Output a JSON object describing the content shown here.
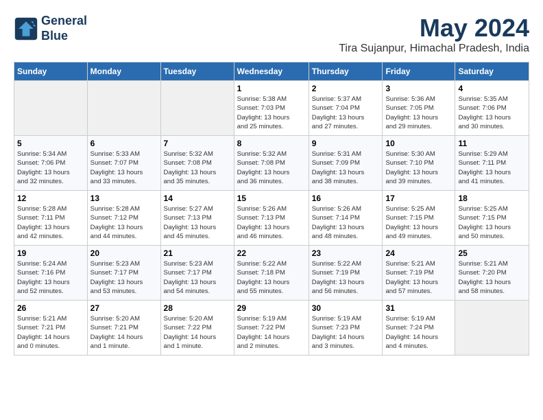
{
  "header": {
    "logo_line1": "General",
    "logo_line2": "Blue",
    "month": "May 2024",
    "location": "Tira Sujanpur, Himachal Pradesh, India"
  },
  "weekdays": [
    "Sunday",
    "Monday",
    "Tuesday",
    "Wednesday",
    "Thursday",
    "Friday",
    "Saturday"
  ],
  "weeks": [
    [
      {
        "day": "",
        "info": ""
      },
      {
        "day": "",
        "info": ""
      },
      {
        "day": "",
        "info": ""
      },
      {
        "day": "1",
        "info": "Sunrise: 5:38 AM\nSunset: 7:03 PM\nDaylight: 13 hours\nand 25 minutes."
      },
      {
        "day": "2",
        "info": "Sunrise: 5:37 AM\nSunset: 7:04 PM\nDaylight: 13 hours\nand 27 minutes."
      },
      {
        "day": "3",
        "info": "Sunrise: 5:36 AM\nSunset: 7:05 PM\nDaylight: 13 hours\nand 29 minutes."
      },
      {
        "day": "4",
        "info": "Sunrise: 5:35 AM\nSunset: 7:06 PM\nDaylight: 13 hours\nand 30 minutes."
      }
    ],
    [
      {
        "day": "5",
        "info": "Sunrise: 5:34 AM\nSunset: 7:06 PM\nDaylight: 13 hours\nand 32 minutes."
      },
      {
        "day": "6",
        "info": "Sunrise: 5:33 AM\nSunset: 7:07 PM\nDaylight: 13 hours\nand 33 minutes."
      },
      {
        "day": "7",
        "info": "Sunrise: 5:32 AM\nSunset: 7:08 PM\nDaylight: 13 hours\nand 35 minutes."
      },
      {
        "day": "8",
        "info": "Sunrise: 5:32 AM\nSunset: 7:08 PM\nDaylight: 13 hours\nand 36 minutes."
      },
      {
        "day": "9",
        "info": "Sunrise: 5:31 AM\nSunset: 7:09 PM\nDaylight: 13 hours\nand 38 minutes."
      },
      {
        "day": "10",
        "info": "Sunrise: 5:30 AM\nSunset: 7:10 PM\nDaylight: 13 hours\nand 39 minutes."
      },
      {
        "day": "11",
        "info": "Sunrise: 5:29 AM\nSunset: 7:11 PM\nDaylight: 13 hours\nand 41 minutes."
      }
    ],
    [
      {
        "day": "12",
        "info": "Sunrise: 5:28 AM\nSunset: 7:11 PM\nDaylight: 13 hours\nand 42 minutes."
      },
      {
        "day": "13",
        "info": "Sunrise: 5:28 AM\nSunset: 7:12 PM\nDaylight: 13 hours\nand 44 minutes."
      },
      {
        "day": "14",
        "info": "Sunrise: 5:27 AM\nSunset: 7:13 PM\nDaylight: 13 hours\nand 45 minutes."
      },
      {
        "day": "15",
        "info": "Sunrise: 5:26 AM\nSunset: 7:13 PM\nDaylight: 13 hours\nand 46 minutes."
      },
      {
        "day": "16",
        "info": "Sunrise: 5:26 AM\nSunset: 7:14 PM\nDaylight: 13 hours\nand 48 minutes."
      },
      {
        "day": "17",
        "info": "Sunrise: 5:25 AM\nSunset: 7:15 PM\nDaylight: 13 hours\nand 49 minutes."
      },
      {
        "day": "18",
        "info": "Sunrise: 5:25 AM\nSunset: 7:15 PM\nDaylight: 13 hours\nand 50 minutes."
      }
    ],
    [
      {
        "day": "19",
        "info": "Sunrise: 5:24 AM\nSunset: 7:16 PM\nDaylight: 13 hours\nand 52 minutes."
      },
      {
        "day": "20",
        "info": "Sunrise: 5:23 AM\nSunset: 7:17 PM\nDaylight: 13 hours\nand 53 minutes."
      },
      {
        "day": "21",
        "info": "Sunrise: 5:23 AM\nSunset: 7:17 PM\nDaylight: 13 hours\nand 54 minutes."
      },
      {
        "day": "22",
        "info": "Sunrise: 5:22 AM\nSunset: 7:18 PM\nDaylight: 13 hours\nand 55 minutes."
      },
      {
        "day": "23",
        "info": "Sunrise: 5:22 AM\nSunset: 7:19 PM\nDaylight: 13 hours\nand 56 minutes."
      },
      {
        "day": "24",
        "info": "Sunrise: 5:21 AM\nSunset: 7:19 PM\nDaylight: 13 hours\nand 57 minutes."
      },
      {
        "day": "25",
        "info": "Sunrise: 5:21 AM\nSunset: 7:20 PM\nDaylight: 13 hours\nand 58 minutes."
      }
    ],
    [
      {
        "day": "26",
        "info": "Sunrise: 5:21 AM\nSunset: 7:21 PM\nDaylight: 14 hours\nand 0 minutes."
      },
      {
        "day": "27",
        "info": "Sunrise: 5:20 AM\nSunset: 7:21 PM\nDaylight: 14 hours\nand 1 minute."
      },
      {
        "day": "28",
        "info": "Sunrise: 5:20 AM\nSunset: 7:22 PM\nDaylight: 14 hours\nand 1 minute."
      },
      {
        "day": "29",
        "info": "Sunrise: 5:19 AM\nSunset: 7:22 PM\nDaylight: 14 hours\nand 2 minutes."
      },
      {
        "day": "30",
        "info": "Sunrise: 5:19 AM\nSunset: 7:23 PM\nDaylight: 14 hours\nand 3 minutes."
      },
      {
        "day": "31",
        "info": "Sunrise: 5:19 AM\nSunset: 7:24 PM\nDaylight: 14 hours\nand 4 minutes."
      },
      {
        "day": "",
        "info": ""
      }
    ]
  ]
}
